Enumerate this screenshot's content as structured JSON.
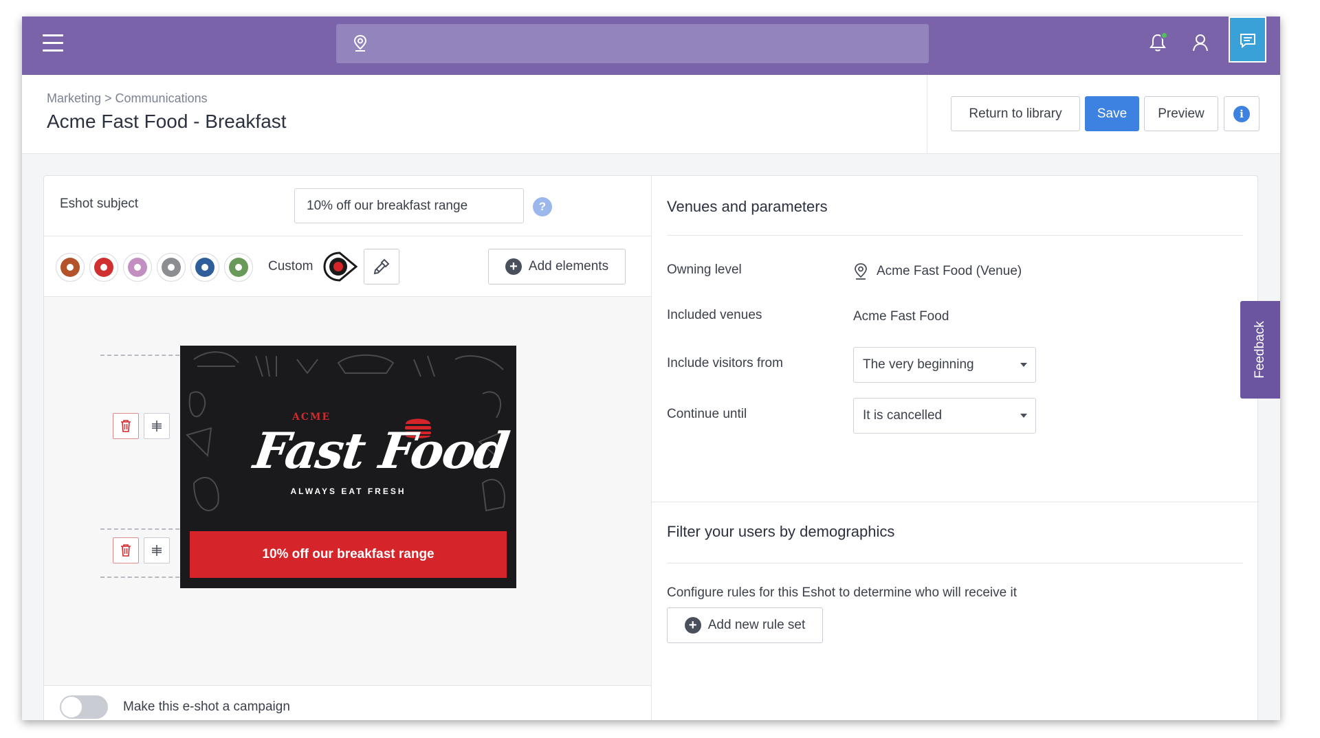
{
  "topbar": {
    "menu_icon": "hamburger-icon",
    "search_icon": "location-pin-icon",
    "search_placeholder": "",
    "notification_icon": "bell-icon",
    "user_icon": "user-icon",
    "chat_icon": "chat-icon",
    "colors": {
      "bar": "#7a63a9",
      "search": "#9484bd",
      "chat": "#3aa0d8",
      "notify_dot": "#4fc15a"
    }
  },
  "header": {
    "breadcrumb": "Marketing > Communications",
    "title": "Acme Fast Food - Breakfast",
    "buttons": {
      "return": "Return to library",
      "save": "Save",
      "preview": "Preview",
      "info": "i"
    },
    "save_color": "#3d82e0"
  },
  "editor": {
    "subject_label": "Eshot subject",
    "subject_value": "10% off our breakfast range",
    "help": "?",
    "swatches": [
      "#b4532a",
      "#d0302f",
      "#c28fc0",
      "#8c8d90",
      "#2f5f9a",
      "#6a9a5a"
    ],
    "custom_label": "Custom",
    "custom_color": "#d6252a",
    "add_elements": "Add elements",
    "preview": {
      "brand_small": "ACME",
      "brand_main": "Fast Food",
      "tagline": "ALWAYS EAT FRESH",
      "cta": "10% off our breakfast range",
      "cta_color": "#d6252a"
    },
    "campaign_label": "Make this e-shot a campaign",
    "campaign_enabled": false
  },
  "venues": {
    "title": "Venues and parameters",
    "owning_level_label": "Owning level",
    "owning_level_value": "Acme Fast Food (Venue)",
    "included_venues_label": "Included venues",
    "included_venues_value": "Acme Fast Food",
    "include_from_label": "Include visitors from",
    "include_from_value": "The very beginning",
    "continue_until_label": "Continue until",
    "continue_until_value": "It is cancelled"
  },
  "filter": {
    "title": "Filter your users by demographics",
    "description": "Configure rules for this Eshot to determine who will receive it",
    "add_rule": "Add new rule set"
  },
  "feedback_tab": "Feedback"
}
